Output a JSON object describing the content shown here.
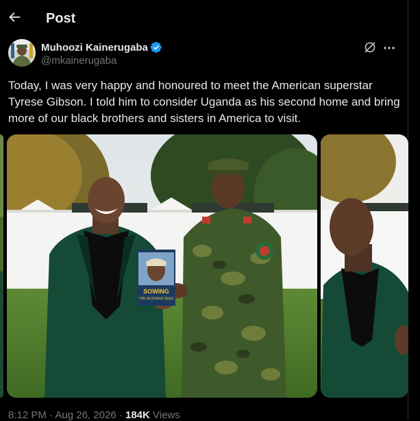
{
  "header": {
    "title": "Post",
    "back_icon": "arrow-left-icon"
  },
  "author": {
    "name": "Muhoozi Kainerugaba",
    "handle": "@mkainerugaba",
    "verified_color": "#1d9bf0"
  },
  "tweet": {
    "text": "Today, I was very happy and honoured to meet the American superstar Tyrese Gibson. I told him to consider Uganda as his second home and bring more of our black brothers and sisters in America to visit."
  },
  "book": {
    "title_line1": "SOWING",
    "title_line2": "THE MUSTARD SEED"
  },
  "meta": {
    "time": "8:12 PM",
    "separator": "·",
    "date": "Aug 26, 2026",
    "views_count": "184K",
    "views_label": "Views"
  },
  "colors": {
    "background": "#000000",
    "text": "#e7e9ea",
    "muted": "#71767b",
    "accent": "#1d9bf0"
  }
}
